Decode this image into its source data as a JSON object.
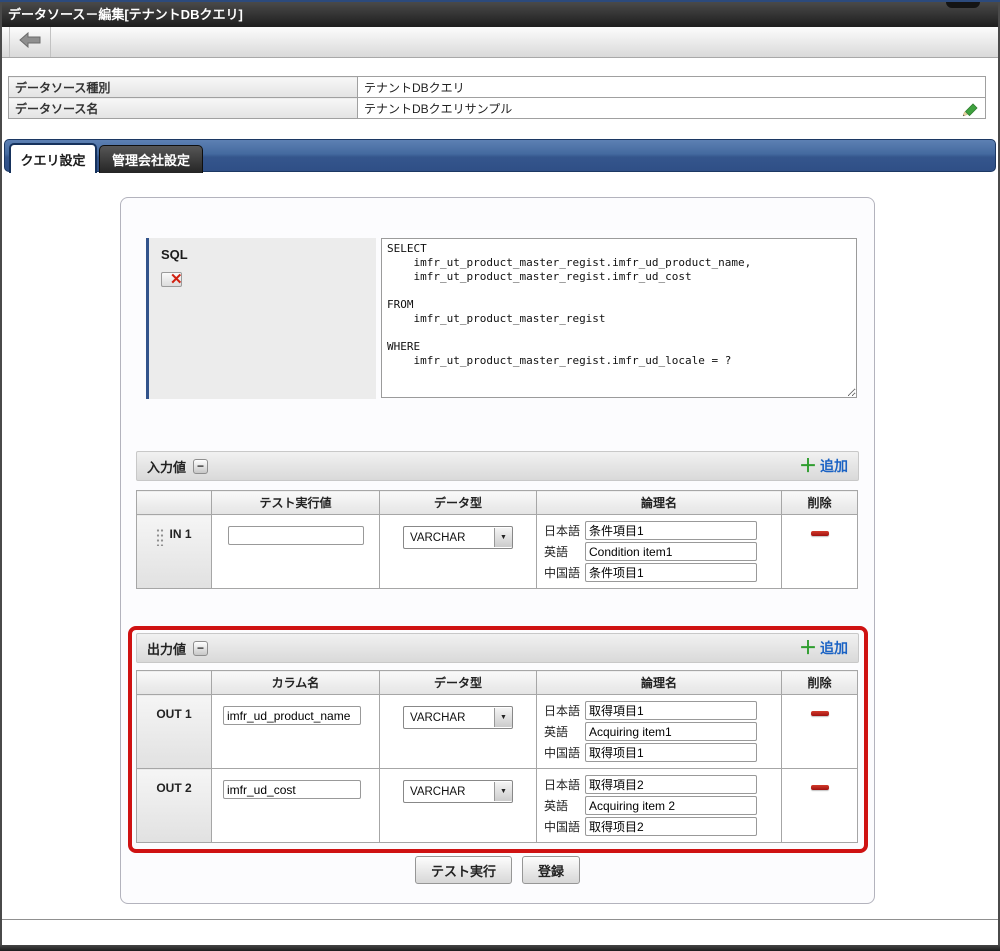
{
  "title_bar": {
    "title": "データソース－編集[テナントDBクエリ]"
  },
  "info_table": {
    "rows": [
      {
        "label": "データソース種別",
        "value": "テナントDBクエリ"
      },
      {
        "label": "データソース名",
        "value": "テナントDBクエリサンプル"
      }
    ]
  },
  "tabs": {
    "items": [
      {
        "label": "クエリ設定",
        "active": true
      },
      {
        "label": "管理会社設定",
        "active": false
      }
    ]
  },
  "panel": {
    "sql": {
      "label": "SQL",
      "value": "SELECT\n    imfr_ut_product_master_regist.imfr_ud_product_name,\n    imfr_ut_product_master_regist.imfr_ud_cost\n\nFROM\n    imfr_ut_product_master_regist\n\nWHERE\n    imfr_ut_product_master_regist.imfr_ud_locale = ?"
    },
    "input_section": {
      "title": "入力値",
      "add_label": "追加",
      "headers": {
        "test_value": "テスト実行値",
        "data_type": "データ型",
        "logical_name": "論理名",
        "delete": "削除"
      },
      "rows": [
        {
          "id": "IN 1",
          "test_value": "",
          "data_type": "VARCHAR",
          "logical": [
            {
              "lang": "日本語",
              "value": "条件項目1"
            },
            {
              "lang": "英語",
              "value": "Condition item1"
            },
            {
              "lang": "中国語",
              "value": "条件项目1"
            }
          ]
        }
      ]
    },
    "output_section": {
      "title": "出力値",
      "add_label": "追加",
      "headers": {
        "column_name": "カラム名",
        "data_type": "データ型",
        "logical_name": "論理名",
        "delete": "削除"
      },
      "rows": [
        {
          "id": "OUT 1",
          "column_name": "imfr_ud_product_name",
          "data_type": "VARCHAR",
          "logical": [
            {
              "lang": "日本語",
              "value": "取得項目1"
            },
            {
              "lang": "英語",
              "value": "Acquiring item1"
            },
            {
              "lang": "中国語",
              "value": "取得项目1"
            }
          ]
        },
        {
          "id": "OUT 2",
          "column_name": "imfr_ud_cost",
          "data_type": "VARCHAR",
          "logical": [
            {
              "lang": "日本語",
              "value": "取得項目2"
            },
            {
              "lang": "英語",
              "value": "Acquiring item 2"
            },
            {
              "lang": "中国語",
              "value": "取得项目2"
            }
          ]
        }
      ]
    },
    "buttons": {
      "test": "テスト実行",
      "register": "登録"
    }
  },
  "icons": {
    "back": "left-arrow",
    "edit": "green-pencil",
    "sql_clear": "checkbox-with-red-x",
    "collapse_minus": "−",
    "add_plus": "＋",
    "dropdown_arrow": "▼",
    "delete": "red-minus-bar"
  },
  "colors": {
    "tab_bar_blue": "#35568d",
    "highlight_red": "#cf1212",
    "add_green": "#2f9e2f",
    "link_blue": "#1a62c4",
    "delete_red": "#a01111",
    "title_bar_dark": "#2b2b2b"
  }
}
